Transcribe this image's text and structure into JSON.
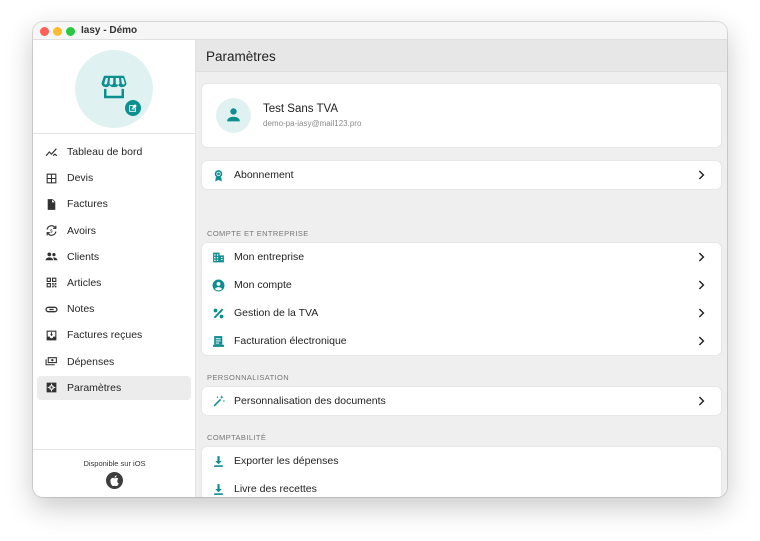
{
  "window": {
    "title": "Iasy - Démo"
  },
  "colors": {
    "accent": "#0e8f8f",
    "accent_light": "#dff2f1"
  },
  "sidebar": {
    "items": [
      {
        "label": "Tableau de bord",
        "icon": "chart-line-icon",
        "active": false
      },
      {
        "label": "Devis",
        "icon": "grid-icon",
        "active": false
      },
      {
        "label": "Factures",
        "icon": "document-icon",
        "active": false
      },
      {
        "label": "Avoirs",
        "icon": "exchange-icon",
        "active": false
      },
      {
        "label": "Clients",
        "icon": "people-icon",
        "active": false
      },
      {
        "label": "Articles",
        "icon": "qr-code-icon",
        "active": false
      },
      {
        "label": "Notes",
        "icon": "link-icon",
        "active": false
      },
      {
        "label": "Factures reçues",
        "icon": "inbox-icon",
        "active": false
      },
      {
        "label": "Dépenses",
        "icon": "cash-icon",
        "active": false
      },
      {
        "label": "Paramètres",
        "icon": "settings-icon",
        "active": true
      }
    ],
    "footer": {
      "text": "Disponible sur iOS",
      "icon": "apple-icon"
    }
  },
  "main": {
    "title": "Paramètres",
    "profile": {
      "name": "Test Sans TVA",
      "email": "demo-pa-iasy@mail123.pro",
      "icon": "person-icon"
    },
    "subscription": {
      "label": "Abonnement",
      "icon": "badge-icon"
    },
    "sections": [
      {
        "title": "COMPTE ET ENTREPRISE",
        "items": [
          {
            "label": "Mon entreprise",
            "icon": "building-icon"
          },
          {
            "label": "Mon compte",
            "icon": "account-circle-icon"
          },
          {
            "label": "Gestion de la TVA",
            "icon": "percent-icon"
          },
          {
            "label": "Facturation électronique",
            "icon": "receipt-icon"
          }
        ]
      },
      {
        "title": "PERSONNALISATION",
        "items": [
          {
            "label": "Personnalisation des documents",
            "icon": "magic-wand-icon"
          }
        ]
      },
      {
        "title": "COMPTABILITÉ",
        "items": [
          {
            "label": "Exporter les dépenses",
            "icon": "download-icon"
          },
          {
            "label": "Livre des recettes",
            "icon": "download-icon"
          }
        ]
      }
    ]
  }
}
